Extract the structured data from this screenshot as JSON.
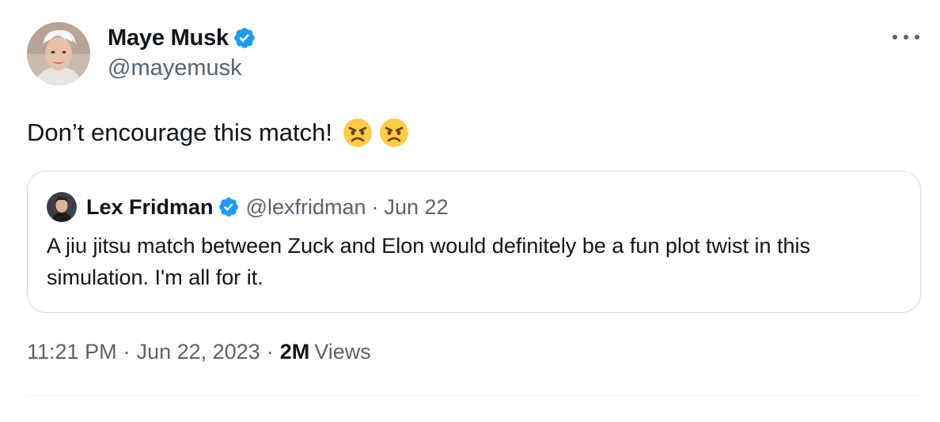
{
  "tweet": {
    "author": {
      "name": "Maye Musk",
      "handle": "@mayemusk",
      "avatar_icon": "portrait-avatar",
      "verified": true
    },
    "more_icon": "more-horizontal-icon",
    "text": "Don’t encourage this match!",
    "emoji": [
      "angry-face-emoji",
      "angry-face-emoji"
    ],
    "quoted": {
      "author_name": "Lex Fridman",
      "author_handle": "@lexfridman",
      "separator": "·",
      "date": "Jun 22",
      "verified": true,
      "text": "A jiu jitsu match between Zuck and Elon would definitely be a fun plot twist in this simulation. I'm all for it."
    },
    "meta": {
      "time": "11:21 PM",
      "separator": "·",
      "date": "Jun 22, 2023",
      "views_count": "2M",
      "views_label": "Views"
    }
  },
  "colors": {
    "verified_blue": "#1d9bf0",
    "secondary_text": "#536471",
    "primary_text": "#0f1419",
    "border": "#cfd9de"
  }
}
